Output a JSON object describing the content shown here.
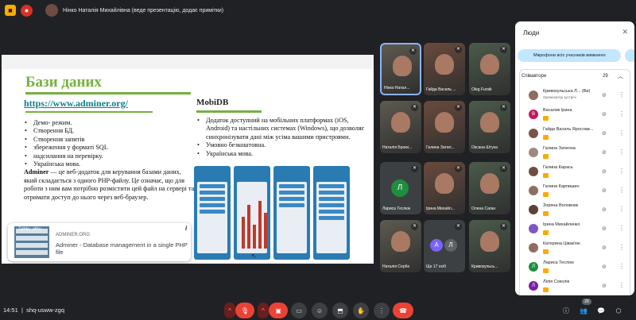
{
  "topbar": {
    "title": "Нінко Наталія Михайлівна (веде презентацію, додає примітки)",
    "icons": [
      "yellow-square-icon",
      "record-icon",
      "presenter-avatar"
    ]
  },
  "slide": {
    "title": "Бази даних",
    "url": "https://www.adminer.org/",
    "left_bullets": [
      "Демо- режим.",
      "Створення БД.",
      "Створення запитів",
      "збереження у форматі SQL",
      "надсилання на перевірку.",
      "Українська мова."
    ],
    "para_bold": "Adminer",
    "para_text": " — це веб-додаток для керування базами даних, який складається з одного PHP-файлу. Це означає, що для роботи з ним вам потрібно розмістити цей файл на сервері та отримати доступ до нього через веб-браузер.",
    "right_heading": "MobiDB",
    "right_bullets": [
      "Додаток доступний на мобільних платформах (iOS, Android) та настільних системах (Windows), що дозволяє синхронізувати дані між усіма вашими пристроями.",
      "Умовно безкоштовна.",
      "Українська мова."
    ],
    "tooltip": {
      "thumb_label": "Table: albu",
      "site": "ADMINER.ORG",
      "description": "Adminer - Database management in a single PHP file"
    },
    "info_mark": "i"
  },
  "tiles": [
    {
      "name": "Нінко Натал...",
      "type": "video",
      "active": true
    },
    {
      "name": "Гайда Василь ...",
      "type": "video"
    },
    {
      "name": "Oleg Fursik",
      "type": "video"
    },
    {
      "name": "Наталія Бромі...",
      "type": "video"
    },
    {
      "name": "Галина Затил...",
      "type": "video"
    },
    {
      "name": "Оксана Штука",
      "type": "video"
    },
    {
      "name": "Лариса Теслюк",
      "type": "avatar",
      "letter": "Л",
      "color": "#1e8e3e"
    },
    {
      "name": "Ірина Михайл...",
      "type": "video"
    },
    {
      "name": "Олена Саган",
      "type": "video"
    },
    {
      "name": "Наталія Сербо",
      "type": "video"
    },
    {
      "name": "Ще 17 осіб",
      "type": "group",
      "letters": [
        "А",
        "Л"
      ]
    },
    {
      "name": "Кривокульсь...",
      "type": "video"
    }
  ],
  "people_panel": {
    "title": "Люди",
    "mute_all_chip": "Мікрофони всіх учасників вимкнено",
    "section_label": "Співавтори",
    "count": "29",
    "people": [
      {
        "name": "Кривокульська Л... (Ви)",
        "sub": "Організатор зустрічі",
        "letter": "",
        "color": "#8d6e63"
      },
      {
        "name": "Васалик Ірина",
        "letter": "В",
        "color": "#c2185b"
      },
      {
        "name": "Гайда Василь Ярослав...",
        "letter": "",
        "color": "#795548"
      },
      {
        "name": "Галина Затилна",
        "letter": "",
        "color": "#a1887f"
      },
      {
        "name": "Галина Карась",
        "letter": "",
        "color": "#6d4c41"
      },
      {
        "name": "Галина Карпишин",
        "letter": "",
        "color": "#8d6e63"
      },
      {
        "name": "Зоряна Воловник",
        "letter": "",
        "color": "#5d4037"
      },
      {
        "name": "Ірина Михайленко",
        "letter": "",
        "color": "#7e57c2"
      },
      {
        "name": "Катерина Цівак'юк",
        "letter": "",
        "color": "#8d6e63"
      },
      {
        "name": "Лариса Теслюк",
        "letter": "Л",
        "color": "#1e8e3e"
      },
      {
        "name": "Лілія Соколік",
        "letter": "Л",
        "color": "#7b1fa2"
      }
    ]
  },
  "bottombar": {
    "time": "14:51",
    "meeting_code": "shq-usww-zgq",
    "people_count": "29"
  }
}
